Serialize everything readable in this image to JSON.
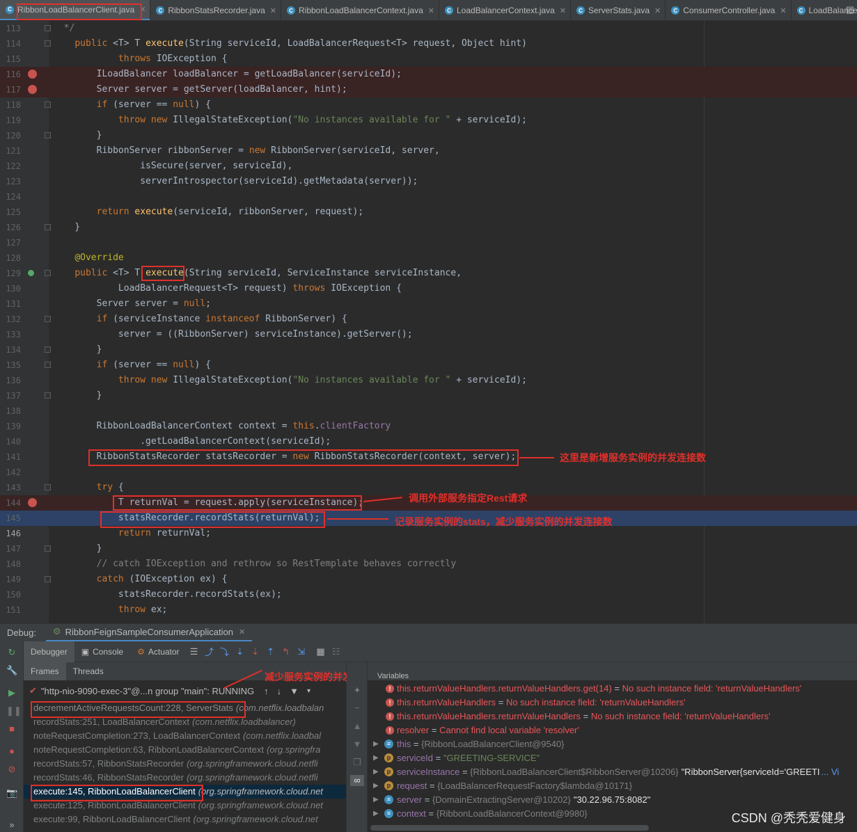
{
  "tabs": [
    {
      "label": "RibbonLoadBalancerClient.java",
      "active": true
    },
    {
      "label": "RibbonStatsRecorder.java"
    },
    {
      "label": "RibbonLoadBalancerContext.java"
    },
    {
      "label": "LoadBalancerContext.java"
    },
    {
      "label": "ServerStats.java"
    },
    {
      "label": "ConsumerController.java"
    },
    {
      "label": "LoadBalancerRe"
    }
  ],
  "editor": {
    "lines": [
      {
        "n": "113",
        "code": "  */"
      },
      {
        "n": "114",
        "code": "    public <T> T execute(String serviceId, LoadBalancerRequest<T> request, Object hint)"
      },
      {
        "n": "115",
        "code": "            throws IOException {"
      },
      {
        "n": "116",
        "code": "        ILoadBalancer loadBalancer = getLoadBalancer(serviceId);"
      },
      {
        "n": "117",
        "code": "        Server server = getServer(loadBalancer, hint);"
      },
      {
        "n": "118",
        "code": "        if (server == null) {"
      },
      {
        "n": "119",
        "code": "            throw new IllegalStateException(\"No instances available for \" + serviceId);"
      },
      {
        "n": "120",
        "code": "        }"
      },
      {
        "n": "121",
        "code": "        RibbonServer ribbonServer = new RibbonServer(serviceId, server,"
      },
      {
        "n": "122",
        "code": "                isSecure(server, serviceId),"
      },
      {
        "n": "123",
        "code": "                serverIntrospector(serviceId).getMetadata(server));"
      },
      {
        "n": "124",
        "code": ""
      },
      {
        "n": "125",
        "code": "        return execute(serviceId, ribbonServer, request);"
      },
      {
        "n": "126",
        "code": "    }"
      },
      {
        "n": "127",
        "code": ""
      },
      {
        "n": "128",
        "code": "    @Override"
      },
      {
        "n": "129",
        "code": "    public <T> T execute(String serviceId, ServiceInstance serviceInstance,"
      },
      {
        "n": "130",
        "code": "            LoadBalancerRequest<T> request) throws IOException {"
      },
      {
        "n": "131",
        "code": "        Server server = null;"
      },
      {
        "n": "132",
        "code": "        if (serviceInstance instanceof RibbonServer) {"
      },
      {
        "n": "133",
        "code": "            server = ((RibbonServer) serviceInstance).getServer();"
      },
      {
        "n": "134",
        "code": "        }"
      },
      {
        "n": "135",
        "code": "        if (server == null) {"
      },
      {
        "n": "136",
        "code": "            throw new IllegalStateException(\"No instances available for \" + serviceId);"
      },
      {
        "n": "137",
        "code": "        }"
      },
      {
        "n": "138",
        "code": ""
      },
      {
        "n": "139",
        "code": "        RibbonLoadBalancerContext context = this.clientFactory"
      },
      {
        "n": "140",
        "code": "                .getLoadBalancerContext(serviceId);"
      },
      {
        "n": "141",
        "code": "        RibbonStatsRecorder statsRecorder = new RibbonStatsRecorder(context, server);"
      },
      {
        "n": "142",
        "code": ""
      },
      {
        "n": "143",
        "code": "        try {"
      },
      {
        "n": "144",
        "code": "            T returnVal = request.apply(serviceInstance);"
      },
      {
        "n": "145",
        "code": "            statsRecorder.recordStats(returnVal);"
      },
      {
        "n": "146",
        "code": "            return returnVal;"
      },
      {
        "n": "147",
        "code": "        }"
      },
      {
        "n": "148",
        "code": "        // catch IOException and rethrow so RestTemplate behaves correctly"
      },
      {
        "n": "149",
        "code": "        catch (IOException ex) {"
      },
      {
        "n": "150",
        "code": "            statsRecorder.recordStats(ex);"
      },
      {
        "n": "151",
        "code": "            throw ex;"
      }
    ],
    "annotations": {
      "line141": "这里是新增服务实例的并发连接数",
      "line144": "调用外部服务指定Rest请求",
      "line145": "记录服务实例的stats，减少服务实例的并发连接数",
      "frames": "减少服务实例的并发连接数"
    }
  },
  "debug": {
    "label": "Debug:",
    "config": "RibbonFeignSampleConsumerApplication",
    "tabs": [
      "Debugger",
      "Console",
      "Actuator"
    ],
    "subtabs": [
      "Frames",
      "Threads"
    ],
    "thread": "\"http-nio-9090-exec-3\"@...n group \"main\": RUNNING",
    "frames": [
      {
        "m": "decrementActiveRequestsCount:228, ServerStats",
        "p": "(com.netflix.loadbalan"
      },
      {
        "m": "recordStats:251, LoadBalancerContext",
        "p": "(com.netflix.loadbalancer)"
      },
      {
        "m": "noteRequestCompletion:273, LoadBalancerContext",
        "p": "(com.netflix.loadbal"
      },
      {
        "m": "noteRequestCompletion:63, RibbonLoadBalancerContext",
        "p": "(org.springfra"
      },
      {
        "m": "recordStats:57, RibbonStatsRecorder",
        "p": "(org.springframework.cloud.netfli"
      },
      {
        "m": "recordStats:46, RibbonStatsRecorder",
        "p": "(org.springframework.cloud.netfli"
      },
      {
        "m": "execute:145, RibbonLoadBalancerClient",
        "p": "(org.springframework.cloud.net"
      },
      {
        "m": "execute:125, RibbonLoadBalancerClient",
        "p": "(org.springframework.cloud.net"
      },
      {
        "m": "execute:99, RibbonLoadBalancerClient",
        "p": "(org.springframework.cloud.net"
      }
    ],
    "variables_header": "Variables",
    "variables": [
      {
        "name": "this.returnValueHandlers.returnValueHandlers.get(14)",
        "value": "No such instance field: 'returnValueHandlers'",
        "err": true
      },
      {
        "name": "this.returnValueHandlers",
        "value": "No such instance field: 'returnValueHandlers'",
        "err": true
      },
      {
        "name": "this.returnValueHandlers.returnValueHandlers",
        "value": "No such instance field: 'returnValueHandlers'",
        "err": true
      },
      {
        "name": "resolver",
        "value": "Cannot find local variable 'resolver'",
        "err": true
      },
      {
        "name": "this",
        "value": "{RibbonLoadBalancerClient@9540}",
        "err": false
      },
      {
        "name": "serviceId",
        "value": "\"GREETING-SERVICE\"",
        "err": false,
        "p": true
      },
      {
        "name": "serviceInstance",
        "value": "{RibbonLoadBalancerClient$RibbonServer@10206}",
        "extra": "\"RibbonServer{serviceId='GREETI",
        "link": "... Vi",
        "err": false,
        "p": true
      },
      {
        "name": "request",
        "value": "{LoadBalancerRequestFactory$lambda@10171}",
        "err": false,
        "p": true
      },
      {
        "name": "server",
        "value": "{DomainExtractingServer@10202}",
        "extra": "\"30.22.96.75:8082\"",
        "err": false
      },
      {
        "name": "context",
        "value": "{RibbonLoadBalancerContext@9980}",
        "err": false
      }
    ]
  },
  "watermark": "CSDN @秃秃爱健身"
}
